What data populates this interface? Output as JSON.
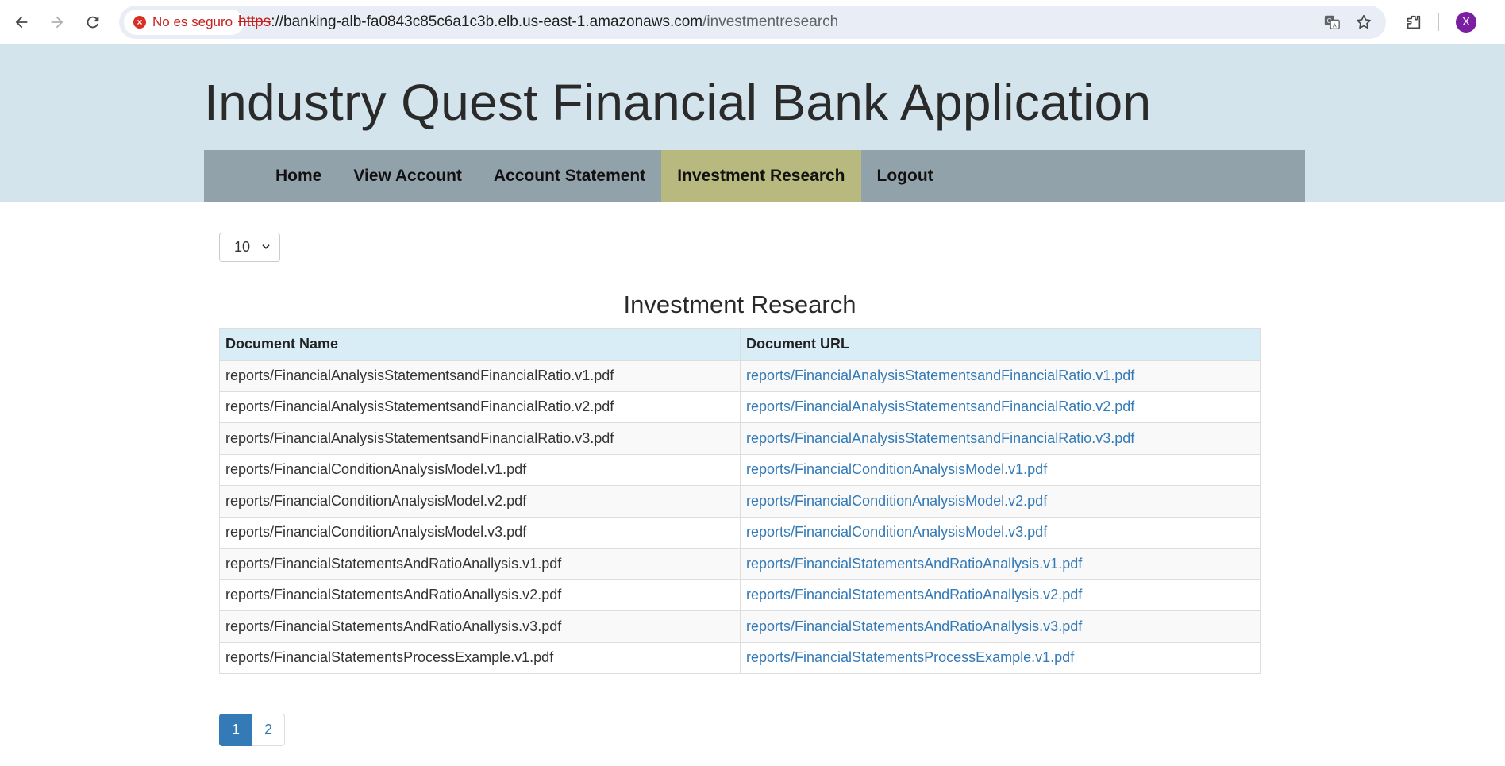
{
  "browser": {
    "security_label": "No es seguro",
    "url_scheme": "https",
    "url_host": "://banking-alb-fa0843c85c6a1c3b.elb.us-east-1.amazonaws.com",
    "url_path": "/investmentresearch",
    "profile_initial": "X"
  },
  "header": {
    "title": "Industry Quest Financial Bank Application"
  },
  "nav": {
    "items": [
      {
        "label": "Home"
      },
      {
        "label": "View Account"
      },
      {
        "label": "Account Statement"
      },
      {
        "label": "Investment Research",
        "active": true
      },
      {
        "label": "Logout"
      }
    ]
  },
  "controls": {
    "page_size": "10"
  },
  "main": {
    "title": "Investment Research",
    "columns": [
      "Document Name",
      "Document URL"
    ],
    "rows": [
      {
        "name": "reports/FinancialAnalysisStatementsandFinancialRatio.v1.pdf",
        "url": "reports/FinancialAnalysisStatementsandFinancialRatio.v1.pdf"
      },
      {
        "name": "reports/FinancialAnalysisStatementsandFinancialRatio.v2.pdf",
        "url": "reports/FinancialAnalysisStatementsandFinancialRatio.v2.pdf"
      },
      {
        "name": "reports/FinancialAnalysisStatementsandFinancialRatio.v3.pdf",
        "url": "reports/FinancialAnalysisStatementsandFinancialRatio.v3.pdf"
      },
      {
        "name": "reports/FinancialConditionAnalysisModel.v1.pdf",
        "url": "reports/FinancialConditionAnalysisModel.v1.pdf"
      },
      {
        "name": "reports/FinancialConditionAnalysisModel.v2.pdf",
        "url": "reports/FinancialConditionAnalysisModel.v2.pdf"
      },
      {
        "name": "reports/FinancialConditionAnalysisModel.v3.pdf",
        "url": "reports/FinancialConditionAnalysisModel.v3.pdf"
      },
      {
        "name": "reports/FinancialStatementsAndRatioAnallysis.v1.pdf",
        "url": "reports/FinancialStatementsAndRatioAnallysis.v1.pdf"
      },
      {
        "name": "reports/FinancialStatementsAndRatioAnallysis.v2.pdf",
        "url": "reports/FinancialStatementsAndRatioAnallysis.v2.pdf"
      },
      {
        "name": "reports/FinancialStatementsAndRatioAnallysis.v3.pdf",
        "url": "reports/FinancialStatementsAndRatioAnallysis.v3.pdf"
      },
      {
        "name": "reports/FinancialStatementsProcessExample.v1.pdf",
        "url": "reports/FinancialStatementsProcessExample.v1.pdf"
      }
    ]
  },
  "pagination": {
    "pages": [
      "1",
      "2"
    ],
    "current": "1"
  },
  "colors": {
    "header_bg": "#d3e4ec",
    "navbar_bg": "#92a2aa",
    "nav_active_bg": "#b8b97f",
    "link": "#337ab7",
    "table_header_bg": "#d9edf7"
  }
}
